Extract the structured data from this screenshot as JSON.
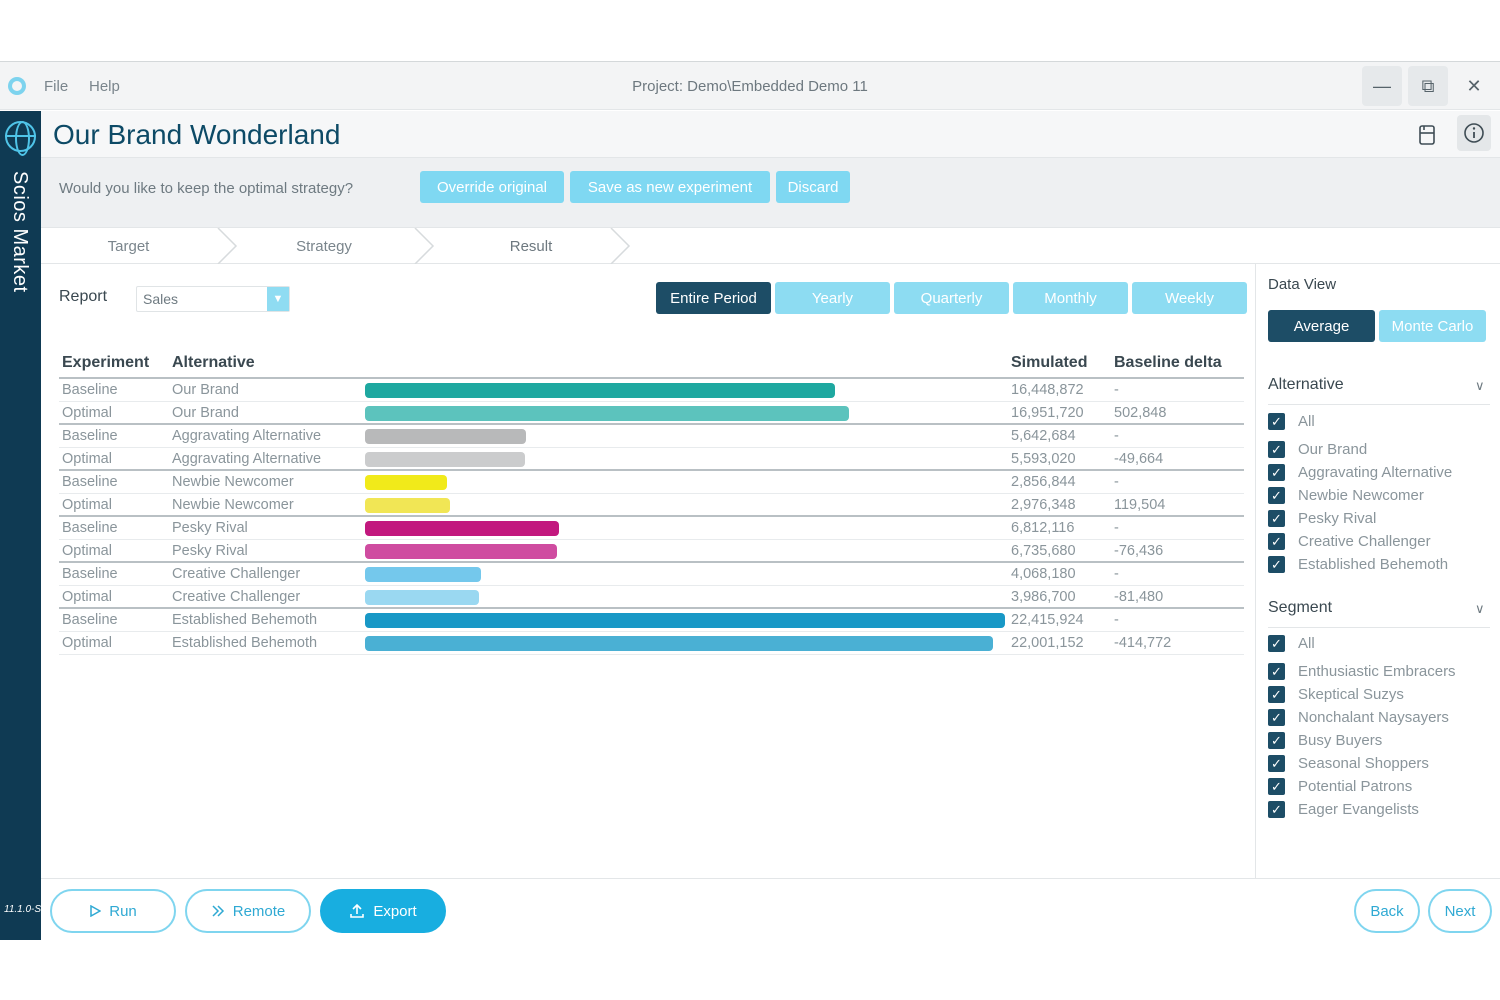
{
  "window": {
    "menu": [
      "File",
      "Help"
    ],
    "project_title": "Project: Demo\\Embedded Demo 11",
    "controls": {
      "minimize": "—",
      "maximize": "⧉",
      "close": "✕"
    }
  },
  "sidebar": {
    "brand": "Scios Market",
    "version": "11.1.0-S"
  },
  "header": {
    "title": "Our Brand Wonderland",
    "icons": [
      "save-icon",
      "info-icon"
    ]
  },
  "optimal_prompt": {
    "question": "Would you like to keep the optimal strategy?",
    "buttons": [
      "Override original",
      "Save as new experiment",
      "Discard"
    ]
  },
  "steps": [
    "Target",
    "Strategy",
    "Result"
  ],
  "report": {
    "label": "Report",
    "selected": "Sales"
  },
  "periods": {
    "options": [
      "Entire Period",
      "Yearly",
      "Quarterly",
      "Monthly",
      "Weekly"
    ],
    "active": "Entire Period"
  },
  "table": {
    "headers": {
      "experiment": "Experiment",
      "alternative": "Alternative",
      "simulated": "Simulated",
      "delta": "Baseline delta"
    },
    "max_value": 22415924,
    "rows": [
      {
        "experiment": "Baseline",
        "alternative": "Our Brand",
        "value": 16448872,
        "simulated": "16,448,872",
        "delta": "-",
        "color": "#1ea8a0"
      },
      {
        "experiment": "Optimal",
        "alternative": "Our Brand",
        "value": 16951720,
        "simulated": "16,951,720",
        "delta": "502,848",
        "color": "#5cc3bd"
      },
      {
        "experiment": "Baseline",
        "alternative": "Aggravating Alternative",
        "value": 5642684,
        "simulated": "5,642,684",
        "delta": "-",
        "color": "#b8b9ba"
      },
      {
        "experiment": "Optimal",
        "alternative": "Aggravating Alternative",
        "value": 5593020,
        "simulated": "5,593,020",
        "delta": "-49,664",
        "color": "#cbcccd"
      },
      {
        "experiment": "Baseline",
        "alternative": "Newbie Newcomer",
        "value": 2856844,
        "simulated": "2,856,844",
        "delta": "-",
        "color": "#f1ea1a"
      },
      {
        "experiment": "Optimal",
        "alternative": "Newbie Newcomer",
        "value": 2976348,
        "simulated": "2,976,348",
        "delta": "119,504",
        "color": "#f1e655"
      },
      {
        "experiment": "Baseline",
        "alternative": "Pesky Rival",
        "value": 6812116,
        "simulated": "6,812,116",
        "delta": "-",
        "color": "#c2187e"
      },
      {
        "experiment": "Optimal",
        "alternative": "Pesky Rival",
        "value": 6735680,
        "simulated": "6,735,680",
        "delta": "-76,436",
        "color": "#cf4ca0"
      },
      {
        "experiment": "Baseline",
        "alternative": "Creative Challenger",
        "value": 4068180,
        "simulated": "4,068,180",
        "delta": "-",
        "color": "#74c8ec"
      },
      {
        "experiment": "Optimal",
        "alternative": "Creative Challenger",
        "value": 3986700,
        "simulated": "3,986,700",
        "delta": "-81,480",
        "color": "#9ad8f1"
      },
      {
        "experiment": "Baseline",
        "alternative": "Established Behemoth",
        "value": 22415924,
        "simulated": "22,415,924",
        "delta": "-",
        "color": "#1898c6"
      },
      {
        "experiment": "Optimal",
        "alternative": "Established Behemoth",
        "value": 22001152,
        "simulated": "22,001,152",
        "delta": "-414,772",
        "color": "#4ab0d4"
      }
    ]
  },
  "data_view": {
    "title": "Data View",
    "options": [
      "Average",
      "Monte Carlo"
    ],
    "active": "Average",
    "alternative": {
      "title": "Alternative",
      "items": [
        "All",
        "Our Brand",
        "Aggravating Alternative",
        "Newbie Newcomer",
        "Pesky Rival",
        "Creative Challenger",
        "Established Behemoth"
      ]
    },
    "segment": {
      "title": "Segment",
      "items": [
        "All",
        "Enthusiastic Embracers",
        "Skeptical Suzys",
        "Nonchalant Naysayers",
        "Busy Buyers",
        "Seasonal Shoppers",
        "Potential Patrons",
        "Eager Evangelists"
      ]
    }
  },
  "footer": {
    "run": "Run",
    "remote": "Remote",
    "export": "Export",
    "back": "Back",
    "next": "Next"
  }
}
